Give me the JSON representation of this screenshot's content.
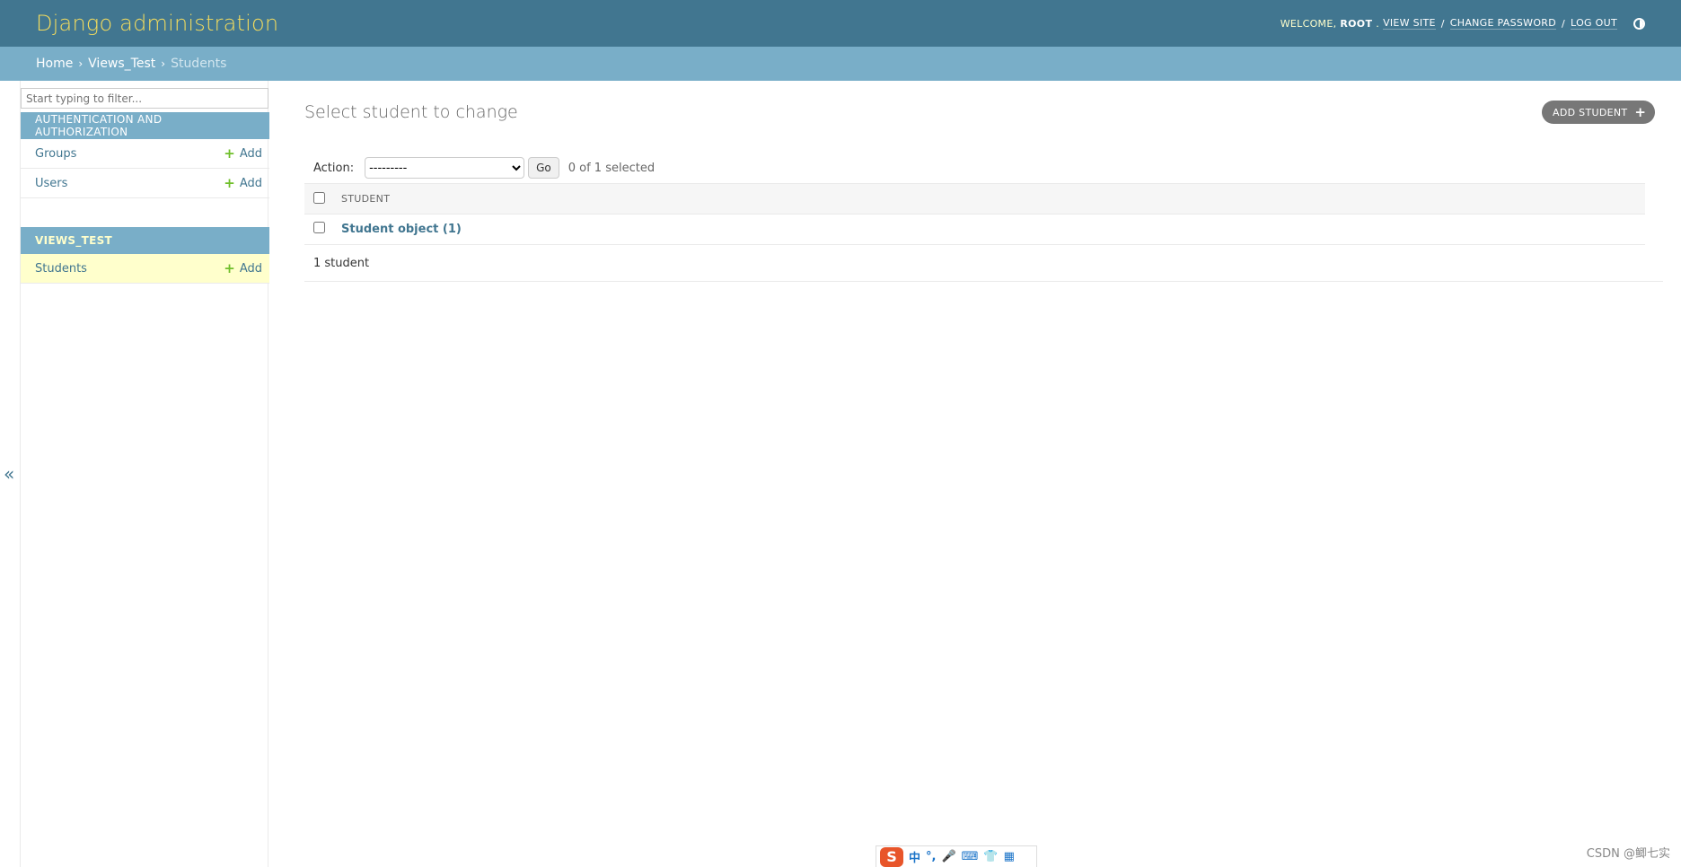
{
  "header": {
    "branding": "Django administration",
    "welcome": "WELCOME,",
    "username": "ROOT",
    "username_suffix": ".",
    "view_site": "VIEW SITE",
    "change_password": "CHANGE PASSWORD",
    "log_out": "LOG OUT",
    "separator": "/"
  },
  "breadcrumbs": {
    "home": "Home",
    "app": "Views_Test",
    "current": "Students",
    "separator": "›"
  },
  "sidebar": {
    "filter_placeholder": "Start typing to filter...",
    "modules": [
      {
        "caption": "AUTHENTICATION AND AUTHORIZATION",
        "rows": [
          {
            "label": "Groups",
            "add": "Add"
          },
          {
            "label": "Users",
            "add": "Add"
          }
        ]
      },
      {
        "caption": "VIEWS_TEST",
        "rows": [
          {
            "label": "Students",
            "add": "Add"
          }
        ]
      }
    ],
    "collapse": "«"
  },
  "content": {
    "title": "Select student to change",
    "add_button": "ADD STUDENT",
    "action_label": "Action:",
    "action_selected": "---------",
    "go": "Go",
    "selection_counter": "0 of 1 selected",
    "column_header": "STUDENT",
    "rows": [
      {
        "label": "Student object (1)"
      }
    ],
    "paginator": "1 student"
  },
  "taskbar": {
    "ime_logo": "S",
    "ime_items": [
      "中",
      "°,",
      "🎤",
      "⌨",
      "👕",
      "▦"
    ],
    "watermark": "CSDN @鲫七实"
  },
  "colors": {
    "header_bg": "#417690",
    "breadcrumbs_bg": "#79aec8",
    "branding": "#f5dd5d",
    "link": "#417690",
    "add_plus": "#70bf2b",
    "current_row": "#ffffcc"
  }
}
